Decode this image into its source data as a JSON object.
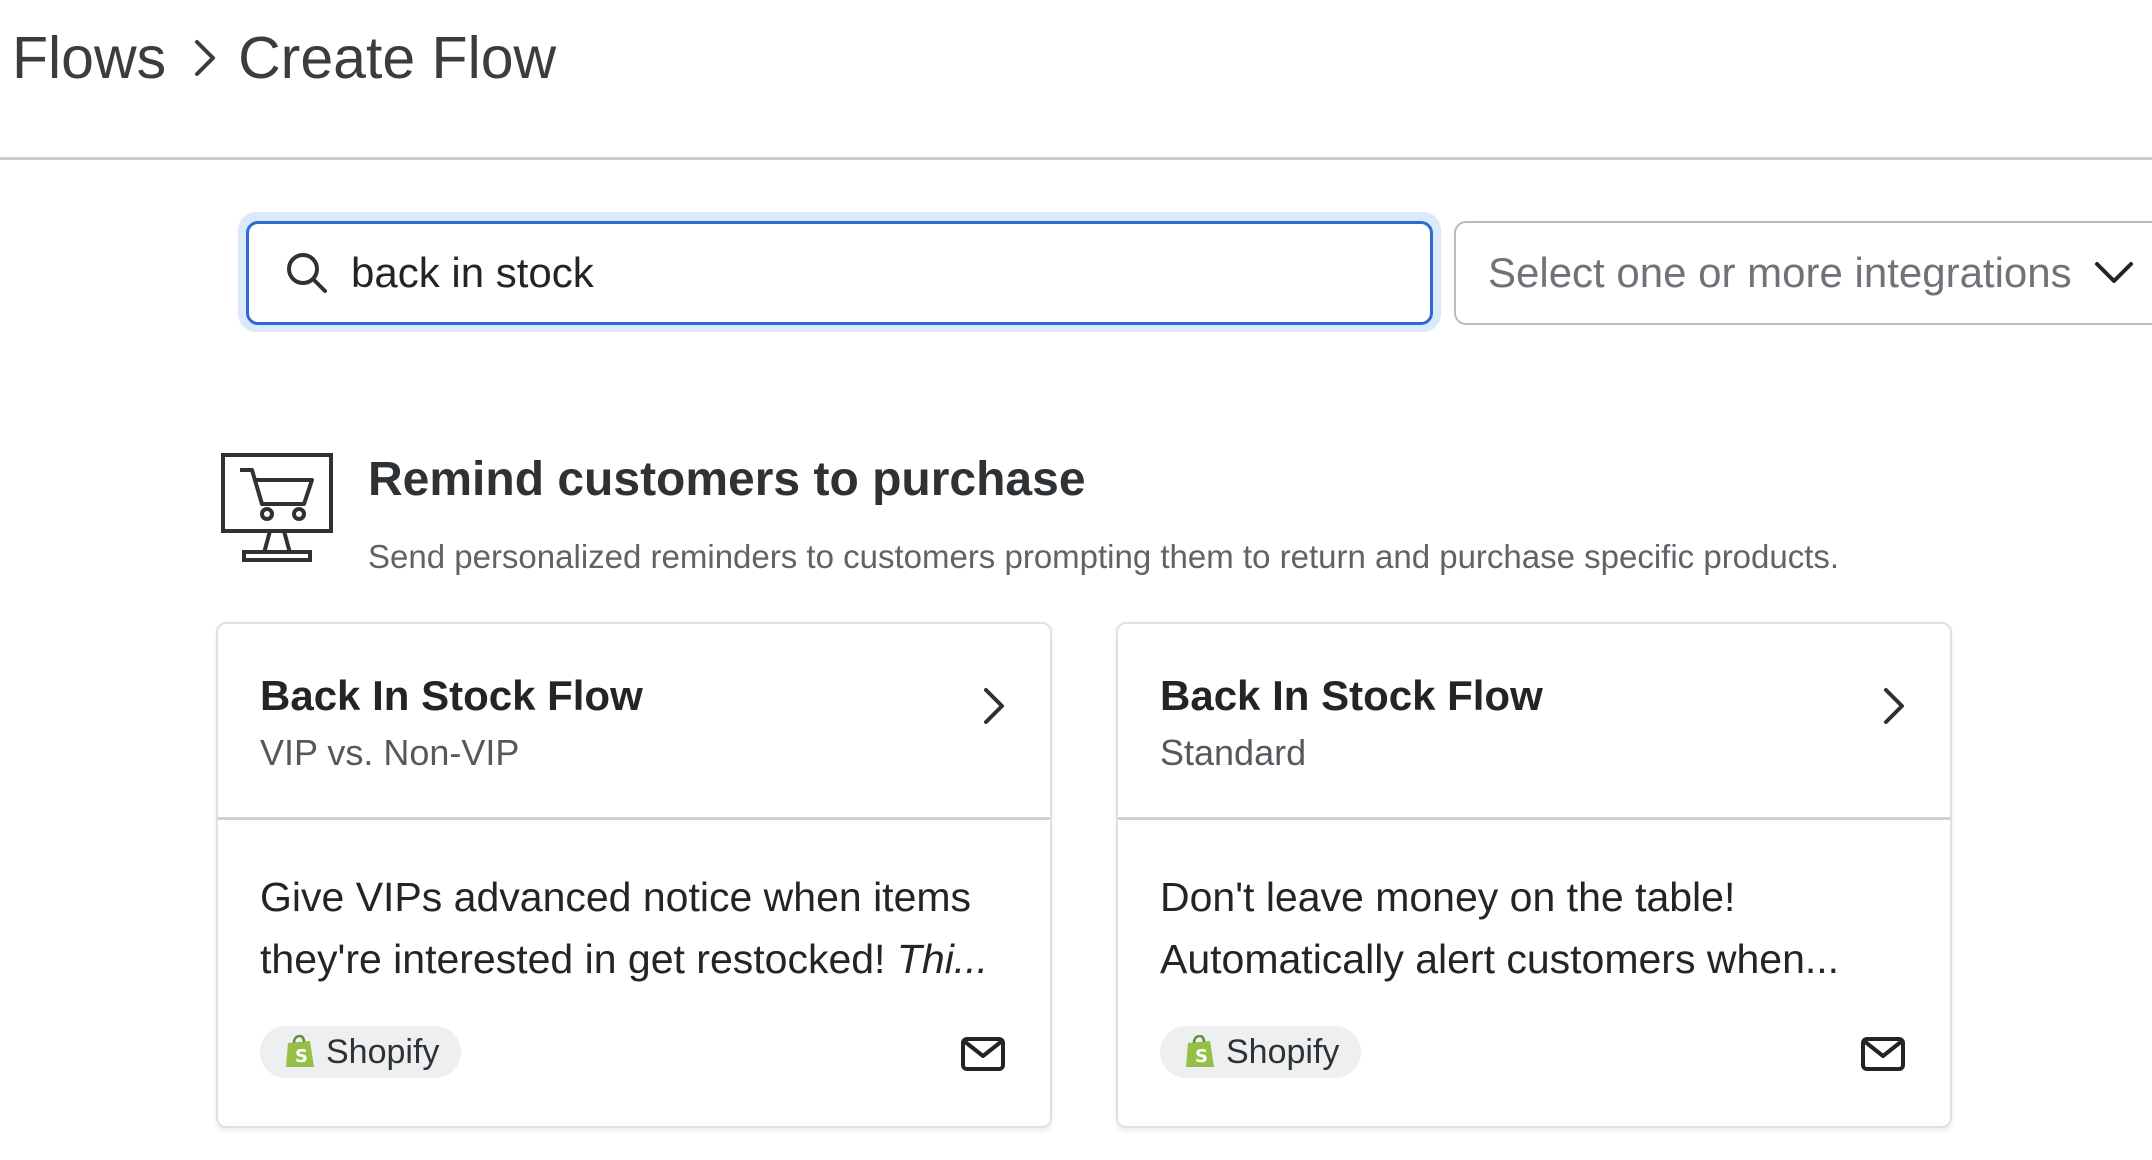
{
  "breadcrumb": {
    "root": "Flows",
    "separator_icon": "chevron-right-icon",
    "current": "Create Flow"
  },
  "search": {
    "value": "back in stock",
    "icon": "search-icon"
  },
  "integrations": {
    "placeholder": "Select one or more integrations",
    "icon": "chevron-down-icon"
  },
  "category": {
    "icon": "shopping-cart-monitor-icon",
    "title": "Remind customers to purchase",
    "description": "Send personalized reminders to customers prompting them to return and purchase specific products."
  },
  "cards": [
    {
      "title": "Back In Stock Flow",
      "subtitle": "VIP vs. Non-VIP",
      "description": "Give VIPs advanced notice when items they're interested in get restocked! ",
      "description_italic": "Thi...",
      "integration": "Shopify",
      "channel_icon": "mail-icon"
    },
    {
      "title": "Back In Stock Flow",
      "subtitle": "Standard",
      "description": "Don't leave money on the table! Automatically alert customers when...",
      "description_italic": "",
      "integration": "Shopify",
      "channel_icon": "mail-icon"
    }
  ],
  "colors": {
    "accent": "#2d6ad6",
    "focus_ring": "#dbe9fb",
    "shopify_green": "#95bf47"
  }
}
